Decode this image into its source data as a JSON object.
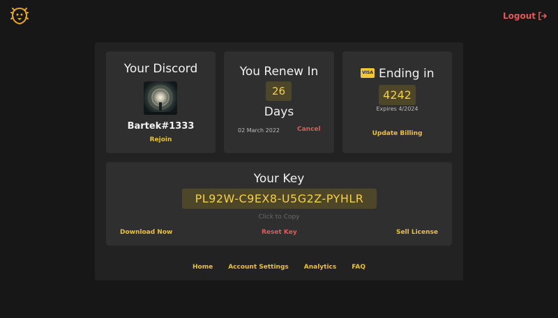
{
  "header": {
    "logout_label": "Logout"
  },
  "discord": {
    "title": "Your Discord",
    "username": "Bartek#1333",
    "rejoin_label": "Rejoin"
  },
  "renew": {
    "title": "You Renew In",
    "days_count": "26",
    "days_label": "Days",
    "date": "02 March 2022",
    "cancel_label": "Cancel"
  },
  "billing": {
    "card_brand": "VISA",
    "title": "Ending in",
    "last_four": "4242",
    "expires": "Expires 4/2024",
    "update_label": "Update Billing"
  },
  "license": {
    "title": "Your Key",
    "key": "PL92W-C9EX8-U5G2Z-PYHLR",
    "copy_hint": "Click to Copy",
    "download_label": "Download Now",
    "reset_label": "Reset Key",
    "sell_label": "Sell License"
  },
  "footer": {
    "links": [
      "Home",
      "Account Settings",
      "Analytics",
      "FAQ"
    ]
  },
  "colors": {
    "accent_yellow": "#e8c23a",
    "accent_red": "#e15a5a",
    "background": "#171717",
    "panel": "#222222",
    "card": "#2f2f2f"
  }
}
